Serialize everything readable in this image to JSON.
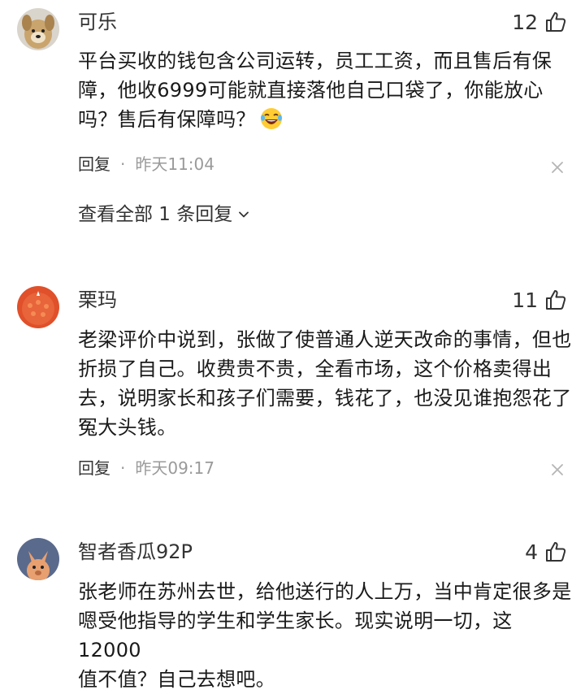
{
  "comments": [
    {
      "username": "可乐",
      "likes": "12",
      "lines": [
        "平台买收的钱包含公司运转，员工工资，而且售后有保",
        "障，他收6999可能就直接落他自己口袋了，你能放心",
        "吗？售后有保障吗？"
      ],
      "emoji": "laughing-tears-emoji",
      "reply_label": "回复",
      "separator": "·",
      "time": "昨天11:04",
      "view_all": "查看全部 1 条回复"
    },
    {
      "username": "栗玛",
      "likes": "11",
      "lines": [
        "老梁评价中说到，张做了使普通人逆天改命的事情，但也",
        "折损了自己。收费贵不贵，全看市场，这个价格卖得出",
        "去，说明家长和孩子们需要，钱花了，也没见谁抱怨花了",
        "冤大头钱。"
      ],
      "reply_label": "回复",
      "separator": "·",
      "time": "昨天09:17"
    },
    {
      "username": "智者香瓜92P",
      "likes": "4",
      "lines": [
        "张老师在苏州去世，给他送行的人上万，当中肯定很多是",
        "嗯受他指导的学生和学生家长。现实说明一切，这12000",
        "值不值？自己去想吧。"
      ]
    }
  ],
  "colors": {
    "text": "#1a1a1a",
    "muted": "#9a9a9a",
    "avatar_1": "#c9a46c",
    "avatar_2": "#e0502a",
    "avatar_3": "#5a6a8c"
  },
  "icons": [
    "thumbs-up-icon",
    "close-icon",
    "chevron-down-icon"
  ]
}
